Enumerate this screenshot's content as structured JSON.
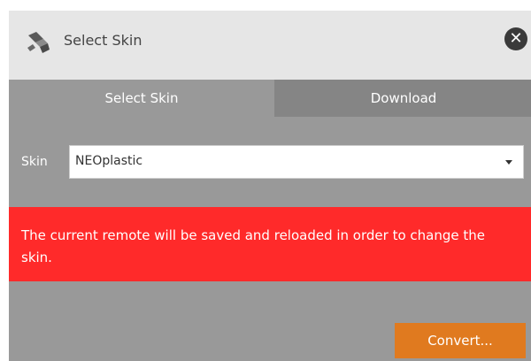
{
  "window": {
    "title": "Select Skin",
    "icon": "paint-brush-icon",
    "close_icon": "close-icon",
    "close_glyph": "✕"
  },
  "tabs": [
    {
      "label": "Select Skin",
      "active": true
    },
    {
      "label": "Download",
      "active": false
    }
  ],
  "skin": {
    "label": "Skin",
    "selected": "NEOplastic"
  },
  "warning": {
    "text": "The current remote will be saved and reloaded in order to change the skin.",
    "color": "#ff2a2a"
  },
  "actions": {
    "convert_label": "Convert..."
  },
  "colors": {
    "accent": "#e07a1f",
    "panel": "#999999",
    "titlebar": "#e6e6e6",
    "inactive_tab": "#858585"
  }
}
